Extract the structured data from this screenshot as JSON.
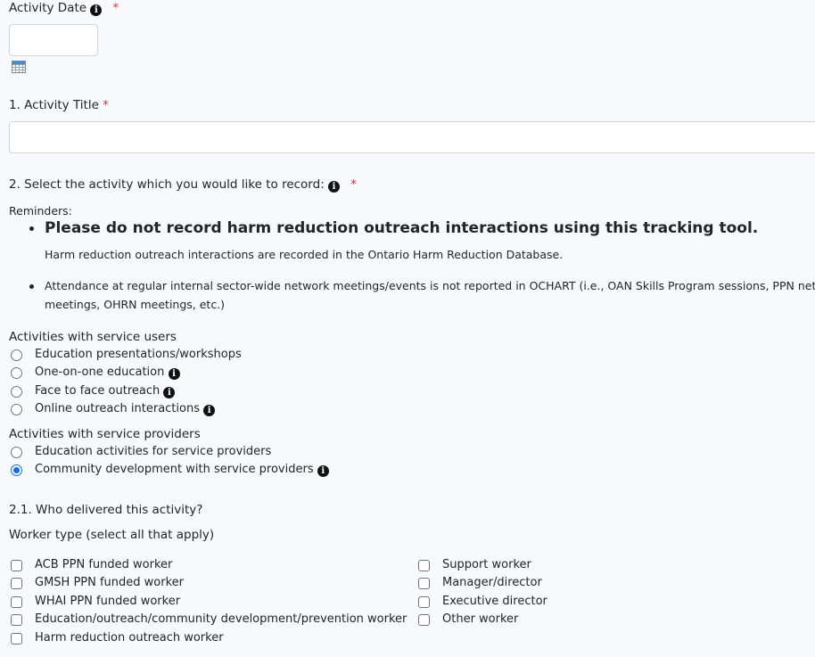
{
  "activity_date": {
    "label": "Activity Date",
    "required_mark": "*",
    "value": "",
    "info_icon": "info-circle-icon",
    "calendar_icon": "calendar-icon"
  },
  "activity_title": {
    "label": "1. Activity Title",
    "required_mark": "*",
    "value": ""
  },
  "activity_select": {
    "label": "2. Select the activity which you would like to record:",
    "required_mark": "*",
    "reminders_label": "Reminders:",
    "reminders": [
      {
        "text": "Please do not record harm reduction outreach interactions using this tracking tool.",
        "note": "Harm reduction outreach interactions are recorded in the Ontario Harm Reduction Database."
      },
      {
        "text": "Attendance at regular internal sector-wide network meetings/events is not reported in OCHART (i.e., OAN Skills Program sessions, PPN network",
        "text_line2": "meetings, OHRN meetings, etc.)"
      }
    ],
    "groups": [
      {
        "label": "Activities with service users",
        "options": [
          {
            "label": "Education presentations/workshops",
            "checked": false,
            "info": false
          },
          {
            "label": "One-on-one education",
            "checked": false,
            "info": true
          },
          {
            "label": "Face to face outreach",
            "checked": false,
            "info": true
          },
          {
            "label": "Online outreach interactions",
            "checked": false,
            "info": true
          }
        ]
      },
      {
        "label": "Activities with service providers",
        "options": [
          {
            "label": "Education activities for service providers",
            "checked": false,
            "info": false
          },
          {
            "label": "Community development with service providers",
            "checked": true,
            "info": true
          }
        ]
      }
    ]
  },
  "delivered_by": {
    "label": "2.1. Who delivered this activity?",
    "worker_type_label": "Worker type (select all that apply)",
    "left_options": [
      {
        "label": "ACB PPN funded worker",
        "checked": false
      },
      {
        "label": "GMSH PPN funded worker",
        "checked": false
      },
      {
        "label": "WHAI PPN funded worker",
        "checked": false
      },
      {
        "label": "Education/outreach/community development/prevention worker",
        "checked": false
      },
      {
        "label": "Harm reduction outreach worker",
        "checked": false
      }
    ],
    "right_options": [
      {
        "label": "Support worker",
        "checked": false
      },
      {
        "label": "Manager/director",
        "checked": false
      },
      {
        "label": "Executive director",
        "checked": false
      },
      {
        "label": "Other worker",
        "checked": false
      }
    ]
  },
  "colors": {
    "accent": "#0d6efd",
    "required": "#e02d2d",
    "background": "#f8f9fc"
  }
}
